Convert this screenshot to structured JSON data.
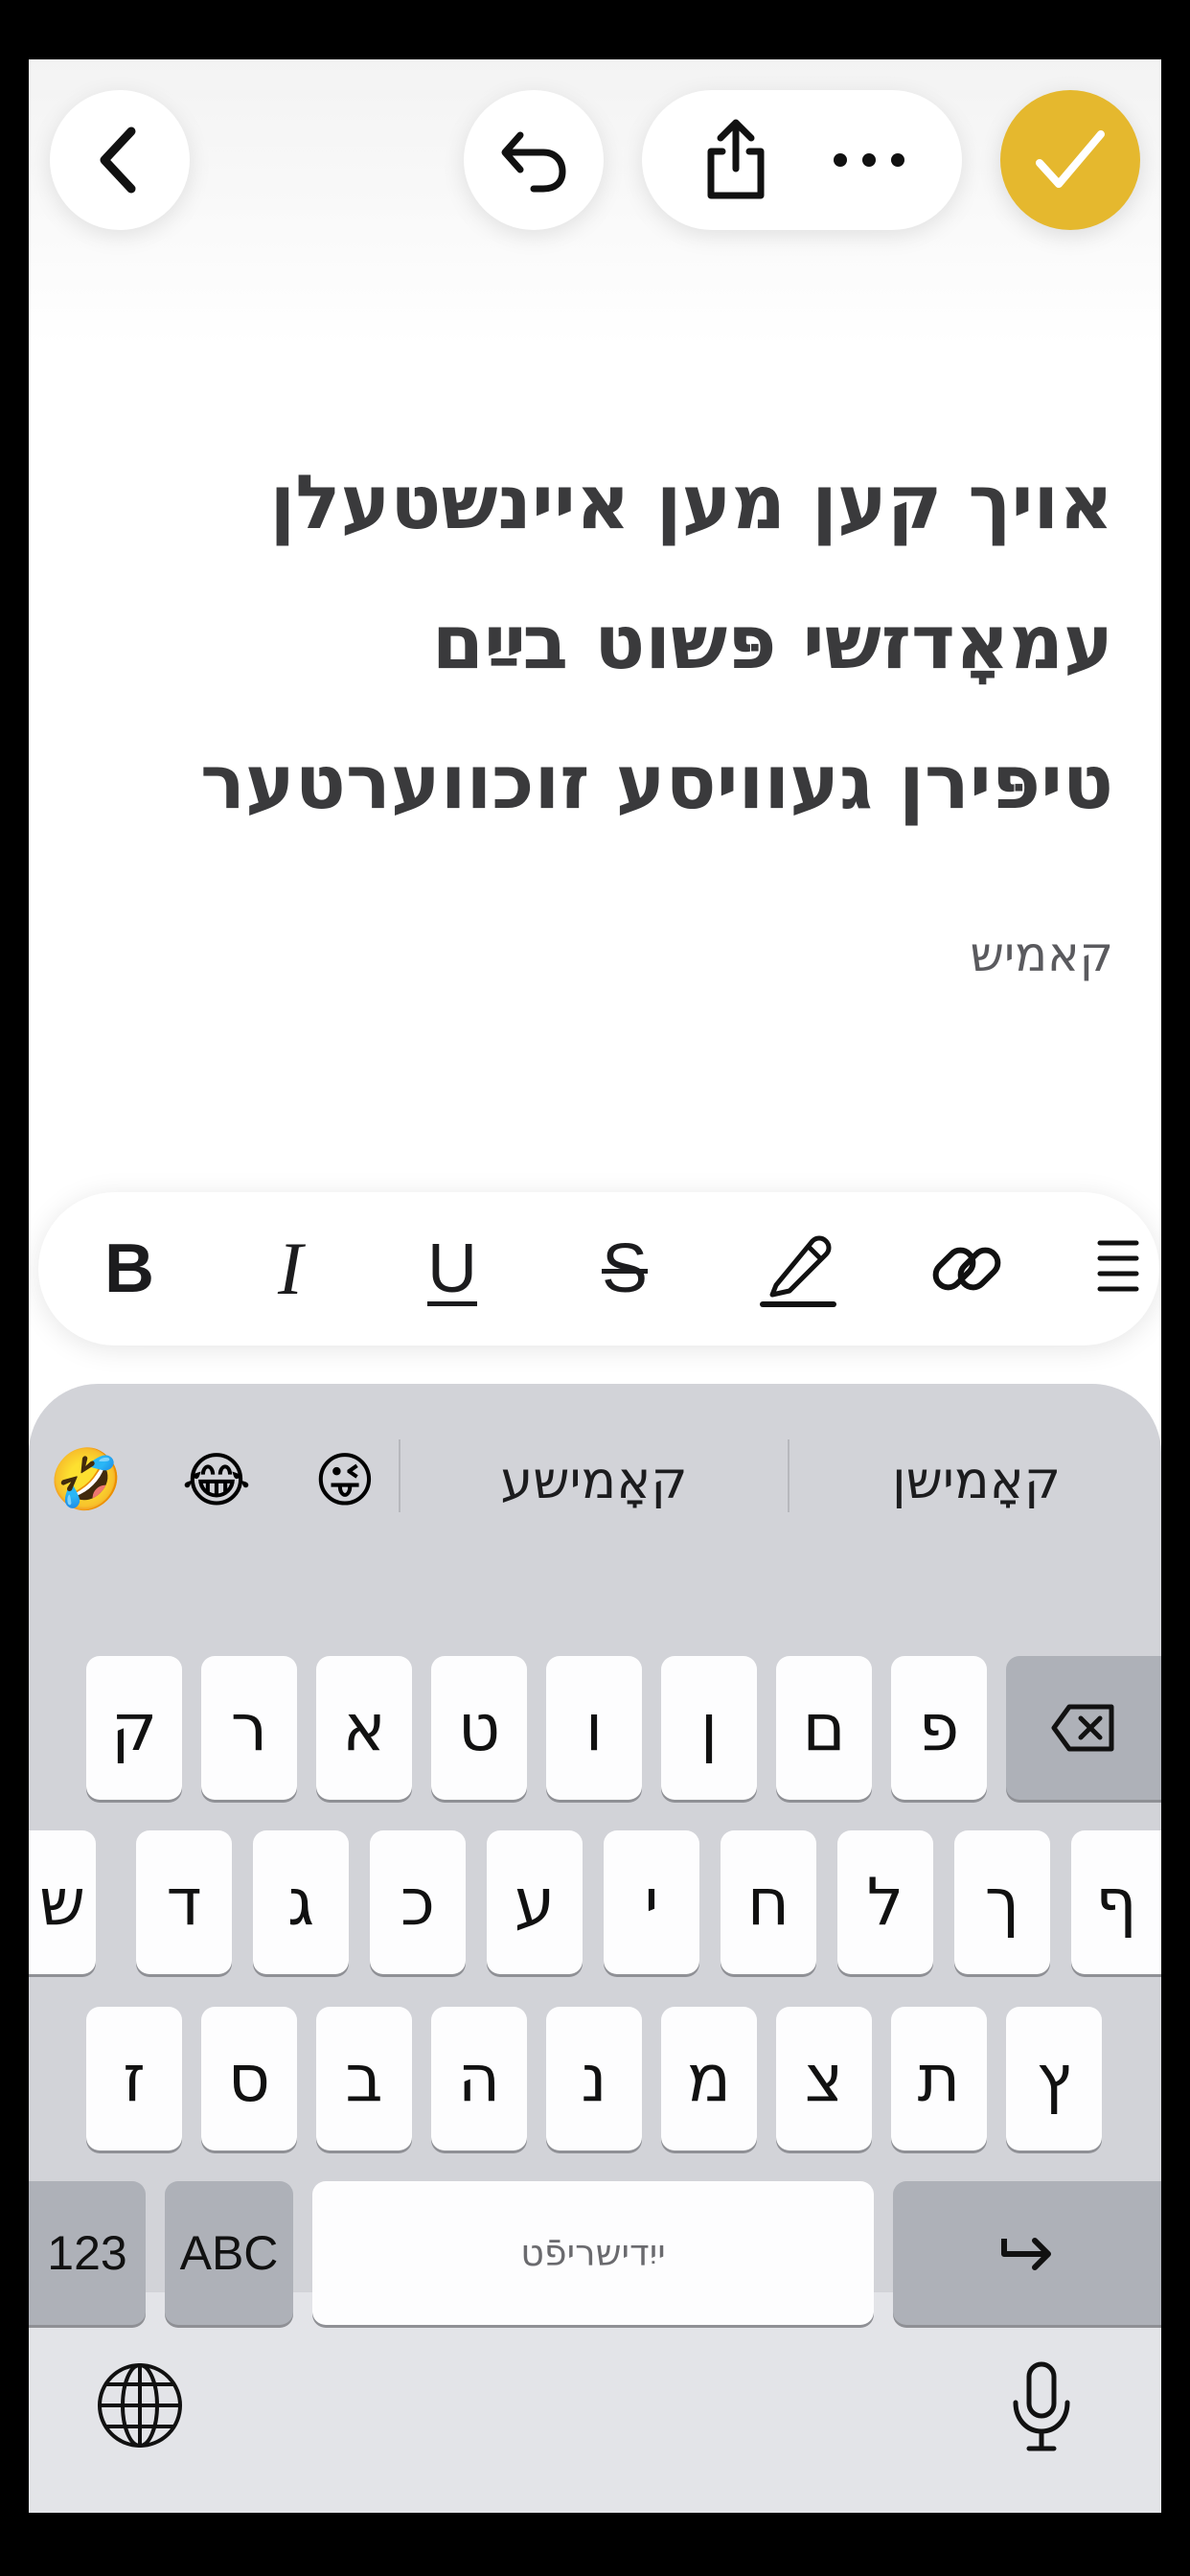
{
  "toolbar": {
    "back": "chevron-left-icon",
    "undo": "undo-icon",
    "share": "share-icon",
    "more": "more-horizontal-icon",
    "done": "checkmark-icon",
    "accent_color": "#e5b82e"
  },
  "note": {
    "title_lines": [
      "אויך קען מען איינשטעלן",
      "עמאָדזשי פּשוט בײַם",
      "טיפּירן געוויסע זוכווערטער"
    ],
    "body": "קאמיש"
  },
  "format_bar": {
    "bold": "B",
    "italic": "I",
    "underline": "U",
    "strikethrough": "S",
    "highlight": "highlighter-icon",
    "link": "link-icon",
    "list": "list-icon"
  },
  "keyboard": {
    "suggestions": {
      "emojis": [
        "🤣",
        "😂",
        "😜"
      ],
      "words": [
        "קאָמישע",
        "קאָמישן"
      ]
    },
    "row1": [
      "ק",
      "ר",
      "א",
      "ט",
      "ו",
      "ן",
      "ם",
      "פ"
    ],
    "row2": [
      "ש",
      "ד",
      "ג",
      "כ",
      "ע",
      "י",
      "ח",
      "ל",
      "ך",
      "ף"
    ],
    "row3": [
      "ז",
      "ס",
      "ב",
      "ה",
      "נ",
      "מ",
      "צ",
      "ת",
      "ץ"
    ],
    "numbers_key": "123",
    "abc_key": "ABC",
    "space_label": "ייִדישריפֿט",
    "return_key": "return-arrow-icon",
    "delete_key": "delete-icon",
    "globe_key": "globe-icon",
    "mic_key": "microphone-icon"
  }
}
